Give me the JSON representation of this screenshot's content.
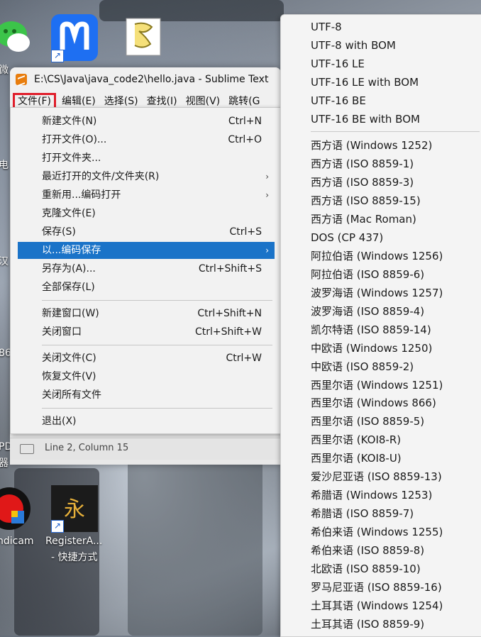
{
  "desktop": {
    "icons": [
      {
        "name": "wechat-icon",
        "label": "微"
      },
      {
        "name": "mindmaster-icon",
        "label": ""
      },
      {
        "name": "script-file-icon",
        "label": ""
      },
      {
        "name": "bandicam-icon",
        "label": "ndicam"
      },
      {
        "name": "register-icon",
        "label": "RegisterA..."
      }
    ],
    "register_sublabel": "- 快捷方式",
    "edge_labels": [
      "电",
      "汉",
      "86",
      "PD",
      "器"
    ]
  },
  "window": {
    "title": "E:\\CS\\Java\\java_code2\\hello.java - Sublime Text",
    "menu": [
      {
        "label": "文件(F)",
        "active": true
      },
      {
        "label": "编辑(E)"
      },
      {
        "label": "选择(S)"
      },
      {
        "label": "查找(I)"
      },
      {
        "label": "视图(V)"
      },
      {
        "label": "跳转(G"
      }
    ]
  },
  "file_menu": {
    "items": [
      {
        "label": "新建文件(N)",
        "shortcut": "Ctrl+N"
      },
      {
        "label": "打开文件(O)...",
        "shortcut": "Ctrl+O"
      },
      {
        "label": "打开文件夹...",
        "shortcut": ""
      },
      {
        "label": "最近打开的文件/文件夹(R)",
        "shortcut": "",
        "arrow": "›"
      },
      {
        "label": "重新用...编码打开",
        "shortcut": "",
        "arrow": "›"
      },
      {
        "label": "克隆文件(E)",
        "shortcut": ""
      },
      {
        "label": "保存(S)",
        "shortcut": "Ctrl+S"
      },
      {
        "label": "以...编码保存",
        "shortcut": "",
        "arrow": "›",
        "highlighted": true
      },
      {
        "label": "另存为(A)...",
        "shortcut": "Ctrl+Shift+S"
      },
      {
        "label": "全部保存(L)",
        "shortcut": ""
      },
      {
        "label": "新建窗口(W)",
        "shortcut": "Ctrl+Shift+N"
      },
      {
        "label": "关闭窗口",
        "shortcut": "Ctrl+Shift+W"
      },
      {
        "label": "关闭文件(C)",
        "shortcut": "Ctrl+W"
      },
      {
        "label": "恢复文件(V)",
        "shortcut": ""
      },
      {
        "label": "关闭所有文件",
        "shortcut": ""
      },
      {
        "label": "退出(X)",
        "shortcut": ""
      }
    ]
  },
  "status_bar": {
    "text": "Line 2, Column 15"
  },
  "encoding_menu": {
    "unicode": [
      "UTF-8",
      "UTF-8 with BOM",
      "UTF-16 LE",
      "UTF-16 LE with BOM",
      "UTF-16 BE",
      "UTF-16 BE with BOM"
    ],
    "others": [
      "西方语 (Windows 1252)",
      "西方语 (ISO 8859-1)",
      "西方语 (ISO 8859-3)",
      "西方语 (ISO 8859-15)",
      "西方语 (Mac Roman)",
      "DOS (CP 437)",
      "阿拉伯语 (Windows 1256)",
      "阿拉伯语 (ISO 8859-6)",
      "波罗海语 (Windows 1257)",
      "波罗海语 (ISO 8859-4)",
      "凯尔特语 (ISO 8859-14)",
      "中欧语 (Windows 1250)",
      "中欧语 (ISO 8859-2)",
      "西里尔语 (Windows 1251)",
      "西里尔语 (Windows 866)",
      "西里尔语 (ISO 8859-5)",
      "西里尔语 (KOI8-R)",
      "西里尔语 (KOI8-U)",
      "爱沙尼亚语 (ISO 8859-13)",
      "希腊语 (Windows 1253)",
      "希腊语 (ISO 8859-7)",
      "希伯来语 (Windows 1255)",
      "希伯来语 (ISO 8859-8)",
      "北欧语 (ISO 8859-10)",
      "罗马尼亚语 (ISO 8859-16)",
      "土耳其语 (Windows 1254)",
      "土耳其语 (ISO 8859-9)"
    ]
  }
}
